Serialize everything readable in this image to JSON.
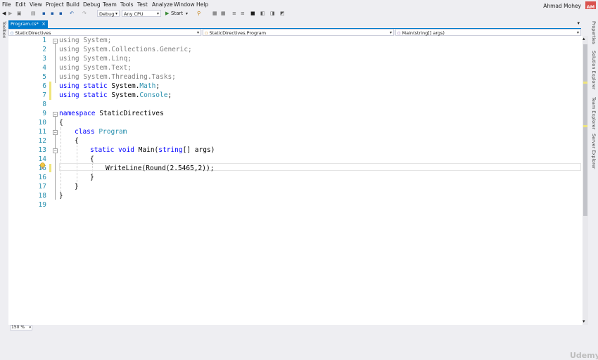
{
  "menu": [
    "File",
    "Edit",
    "View",
    "Project",
    "Build",
    "Debug",
    "Team",
    "Tools",
    "Test",
    "Analyze",
    "Window",
    "Help"
  ],
  "user": {
    "name": "Ahmad Mohey",
    "initials": "AM"
  },
  "toolbar": {
    "config": "Debug",
    "platform": "Any CPU",
    "start_label": "Start"
  },
  "left_strip_label": "Toolbox",
  "right_strip_labels": [
    "Properties",
    "Solution Explorer",
    "Team Explorer",
    "Server Explorer"
  ],
  "tab": {
    "name": "Program.cs*",
    "close": "×"
  },
  "nav": {
    "project": "StaticDirectives",
    "type": "StaticDirectives.Program",
    "member": "Main(string[] args)"
  },
  "editor": {
    "lines": [
      "1",
      "2",
      "3",
      "4",
      "5",
      "6",
      "7",
      "8",
      "9",
      "10",
      "11",
      "12",
      "13",
      "14",
      "15",
      "16",
      "17",
      "18",
      "19"
    ],
    "code": {
      "l1": {
        "kw": "using",
        "rest": " System;"
      },
      "l2": {
        "kw": "using",
        "rest": " System.Collections.Generic;"
      },
      "l3": {
        "kw": "using",
        "rest": " System.Linq;"
      },
      "l4": {
        "kw": "using",
        "rest": " System.Text;"
      },
      "l5": {
        "kw": "using",
        "rest": " System.Threading.Tasks;"
      },
      "l6": {
        "kw1": "using",
        "kw2": " static",
        "ns": " System.",
        "cls": "Math",
        "end": ";"
      },
      "l7": {
        "kw1": "using",
        "kw2": " static",
        "ns": " System.",
        "cls": "Console",
        "end": ";"
      },
      "l9": {
        "kw": "namespace",
        "rest": " StaticDirectives"
      },
      "l10": "{",
      "l11": {
        "kw": "class",
        "cls": " Program"
      },
      "l12": "{",
      "l13": {
        "kw1": "static",
        "kw2": " void",
        "mid": " Main(",
        "kw3": "string",
        "end": "[] args)"
      },
      "l14": "{",
      "l15": "WriteLine(Round(2.5465,2));",
      "l16": "}",
      "l17": "}",
      "l18": "}"
    }
  },
  "zoom": "150 %",
  "watermark": "Udemy"
}
